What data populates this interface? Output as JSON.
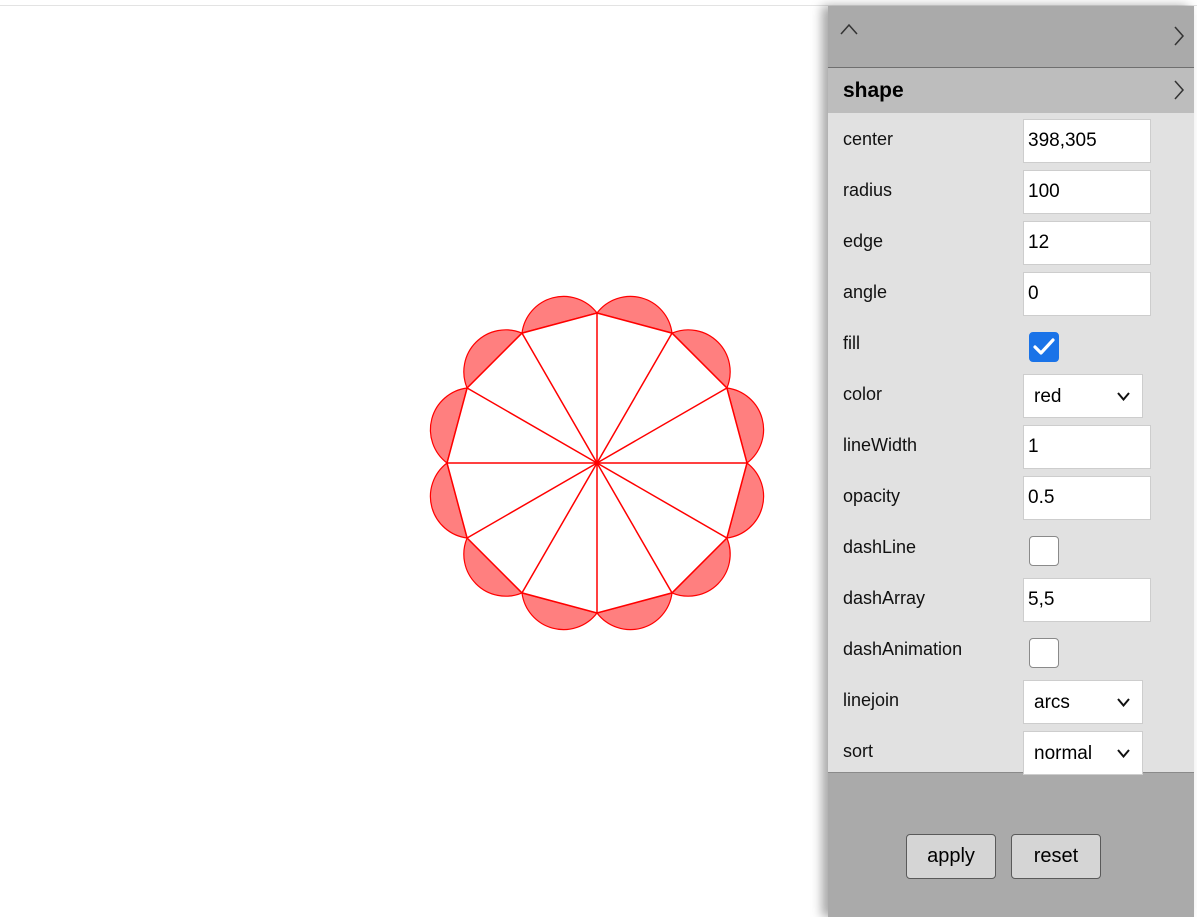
{
  "canvas": {
    "shape": {
      "edge_count": 12,
      "stroke_color": "#ff0000",
      "fill_color": "#ff0000",
      "fill_opacity": 0.5
    }
  },
  "panel": {
    "section_title": "shape",
    "properties": [
      {
        "label": "center",
        "type": "text",
        "value": "398,305"
      },
      {
        "label": "radius",
        "type": "text",
        "value": "100"
      },
      {
        "label": "edge",
        "type": "text",
        "value": "12"
      },
      {
        "label": "angle",
        "type": "text",
        "value": "0"
      },
      {
        "label": "fill",
        "type": "checkbox",
        "checked": true
      },
      {
        "label": "color",
        "type": "select",
        "value": "red"
      },
      {
        "label": "lineWidth",
        "type": "text",
        "value": "1"
      },
      {
        "label": "opacity",
        "type": "text",
        "value": "0.5"
      },
      {
        "label": "dashLine",
        "type": "checkbox",
        "checked": false
      },
      {
        "label": "dashArray",
        "type": "text",
        "value": "5,5"
      },
      {
        "label": "dashAnimation",
        "type": "checkbox",
        "checked": false
      },
      {
        "label": "linejoin",
        "type": "select",
        "value": "arcs"
      },
      {
        "label": "sort",
        "type": "select",
        "value": "normal"
      }
    ],
    "buttons": {
      "apply_label": "apply",
      "reset_label": "reset"
    },
    "icons": {
      "collapse": "chevron-up-icon",
      "topbar_expand": "chevron-right-icon",
      "section_expand": "chevron-right-icon",
      "select_arrow": "chevron-down-icon",
      "checkmark": "checkmark-icon"
    },
    "colors": {
      "panel_bg": "#aaaaaa",
      "header_bg": "#bdbdbd",
      "props_bg": "#e1e1e1",
      "checkbox_checked": "#1a73e8"
    }
  }
}
